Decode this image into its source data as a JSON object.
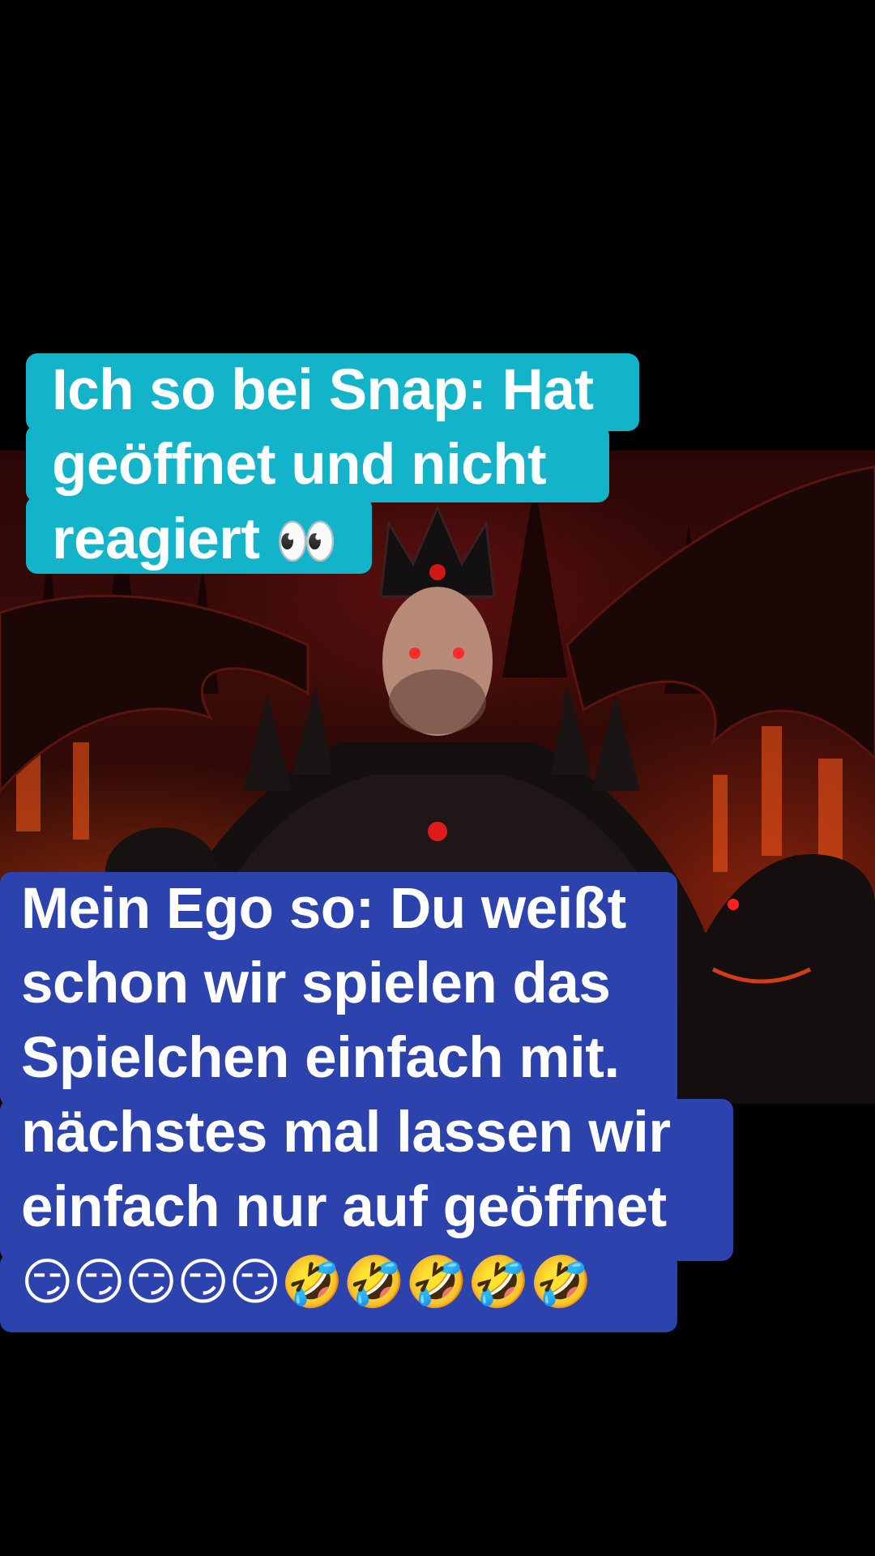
{
  "background": {
    "page_color": "#000000",
    "artwork_description_icon": "demon-king-artwork"
  },
  "caption_top": {
    "color": "#13b3c9",
    "lines": [
      "Ich so bei Snap: Hat",
      "geöffnet und nicht",
      "reagiert"
    ],
    "emoji": "👀"
  },
  "caption_bottom": {
    "color": "#2c42ad",
    "lines": [
      "Mein Ego so: Du weißt",
      "schon wir spielen das",
      "Spielchen einfach mit.",
      "nächstes mal lassen wir",
      "einfach nur auf geöffnet"
    ],
    "emoji": "😏😏😏😏😏🤣🤣🤣🤣🤣"
  }
}
